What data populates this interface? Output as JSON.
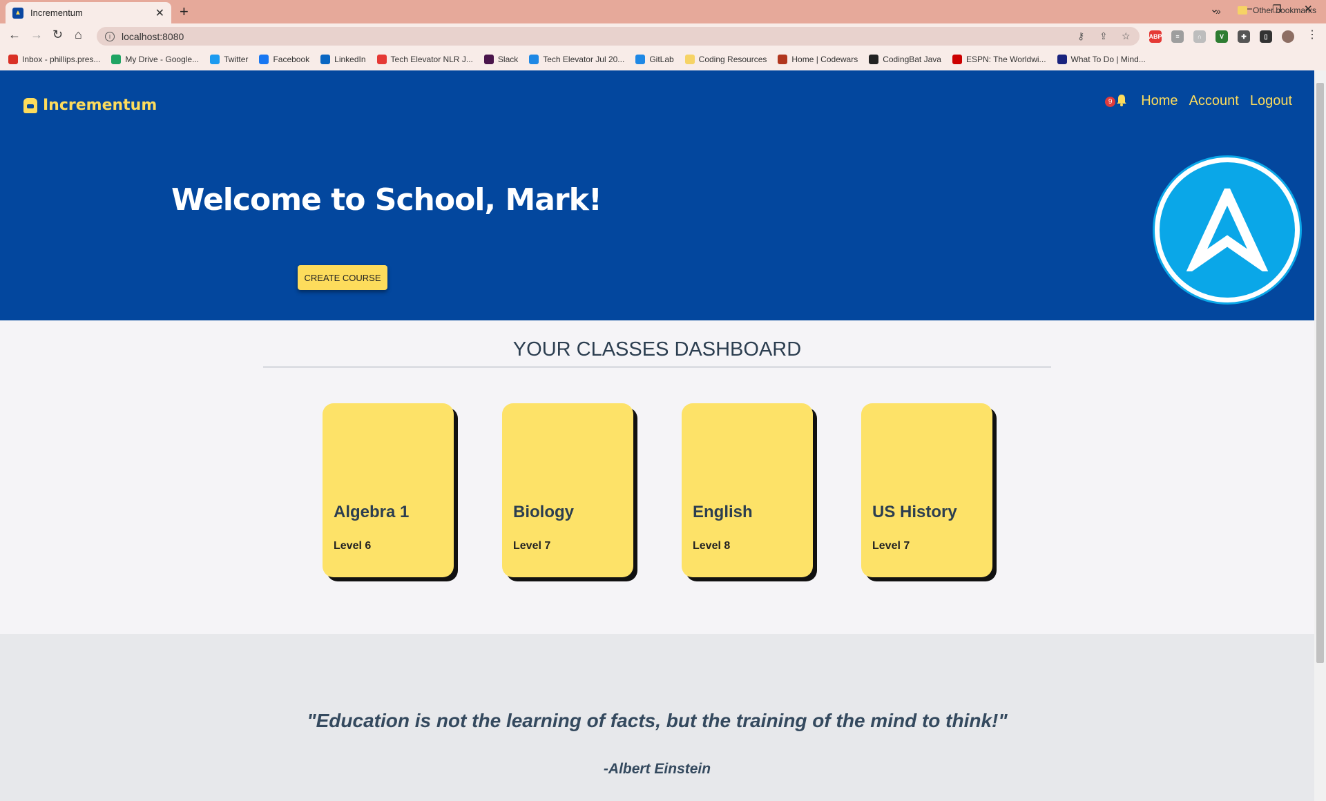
{
  "browser": {
    "tab_title": "Incrementum",
    "url": "localhost:8080",
    "bookmarks": [
      {
        "label": "Inbox - phillips.pres...",
        "color": "#d93025"
      },
      {
        "label": "My Drive - Google...",
        "color": "#1fa463"
      },
      {
        "label": "Twitter",
        "color": "#1d9bf0"
      },
      {
        "label": "Facebook",
        "color": "#1877f2"
      },
      {
        "label": "LinkedIn",
        "color": "#0a66c2"
      },
      {
        "label": "Tech Elevator NLR J...",
        "color": "#e53935"
      },
      {
        "label": "Slack",
        "color": "#4a154b"
      },
      {
        "label": "Tech Elevator Jul 20...",
        "color": "#1e88e5"
      },
      {
        "label": "GitLab",
        "color": "#1e88e5"
      },
      {
        "label": "Coding Resources",
        "color": "#f6d365"
      },
      {
        "label": "Home | Codewars",
        "color": "#b1361e"
      },
      {
        "label": "CodingBat Java",
        "color": "#222222"
      },
      {
        "label": "ESPN: The Worldwi...",
        "color": "#cc0000"
      },
      {
        "label": "What To Do | Mind...",
        "color": "#1a237e"
      }
    ],
    "more_bookmarks": "»",
    "other_bookmarks": "Other bookmarks"
  },
  "header": {
    "brand": "Incrementum",
    "notification_count": "9",
    "nav": {
      "home": "Home",
      "account": "Account",
      "logout": "Logout"
    }
  },
  "hero": {
    "welcome": "Welcome to School, Mark!",
    "create_button": "CREATE COURSE"
  },
  "dashboard": {
    "title": "YOUR CLASSES DASHBOARD",
    "classes": [
      {
        "name": "Algebra 1",
        "level": "Level 6"
      },
      {
        "name": "Biology",
        "level": "Level 7"
      },
      {
        "name": "English",
        "level": "Level 8"
      },
      {
        "name": "US History",
        "level": "Level 7"
      }
    ]
  },
  "quote": {
    "text": "\"Education is not the learning of facts, but the training of the mind to think!\"",
    "author": "-Albert Einstein"
  },
  "colors": {
    "primary_blue": "#03479e",
    "accent_yellow": "#fddc5c",
    "card_yellow": "#fde268",
    "logo_cyan": "#0aa7e8"
  }
}
